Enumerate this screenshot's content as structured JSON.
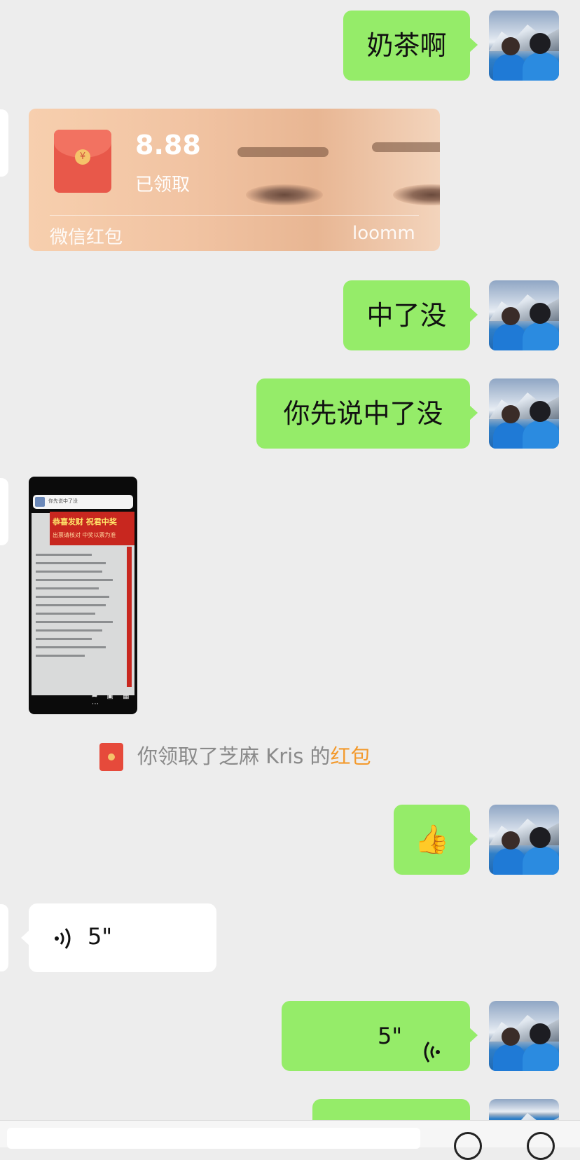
{
  "messages": {
    "m1": {
      "text": "奶茶啊"
    },
    "packet": {
      "amount": "8.88",
      "status": "已领取",
      "brand": "微信红包",
      "cover_label": "loomm"
    },
    "m2": {
      "text": "中了没"
    },
    "m3": {
      "text": "你先说中了没"
    },
    "image": {
      "banner_title": "恭喜发财 祝君中奖",
      "banner_sub": "出票请核对 中奖以票为准",
      "notif_text": "你先说中了没",
      "toolbar_icons": "➦ ▣ ▦ ⋯"
    },
    "system": {
      "prefix": "你领取了芝麻 Kris 的",
      "link": "红包"
    },
    "m4": {
      "emoji": "👍"
    },
    "voice_in": {
      "duration": "5\"",
      "icon": "voice-wave-icon"
    },
    "voice_out": {
      "duration": "5\"",
      "icon": "voice-wave-icon"
    }
  },
  "colors": {
    "background": "#ededed",
    "outgoing_bubble": "#95ec69",
    "incoming_bubble": "#ffffff",
    "link": "#f39a2d",
    "red_packet": "#e8584a"
  }
}
